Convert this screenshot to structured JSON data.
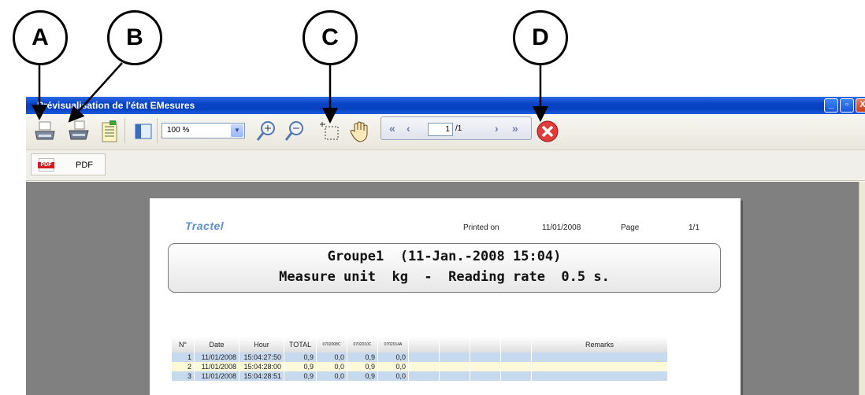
{
  "callouts": [
    "A",
    "B",
    "C",
    "D"
  ],
  "window": {
    "title": "Prévisualisation de l'état EMesures",
    "controls": {
      "minimize": "_",
      "restore": "▫",
      "close": "X"
    }
  },
  "toolbar": {
    "buttons": [
      "print-icon",
      "print-setup-icon",
      "export-icon",
      "page-layout-icon",
      "zoom-in-icon",
      "zoom-out-icon",
      "zoom-select-icon",
      "hand-pan-icon",
      "close-preview-icon"
    ],
    "zoom_value": "100 %",
    "nav": {
      "first": "«",
      "prev": "‹",
      "page": "1",
      "total": "/1",
      "next": "›",
      "last": "»"
    }
  },
  "export_bar": {
    "pdf_icon_text": "PDF",
    "pdf_label": "PDF"
  },
  "report": {
    "logo_text": "Tractel",
    "printed_on_label": "Printed on",
    "printed_on_value": "11/01/2008",
    "page_label": "Page",
    "page_value": "1/1",
    "banner_line1": "Groupe1  (11-Jan.-2008 15:04)",
    "banner_line2": "Measure unit  kg  -  Reading rate  0.5 s.",
    "table": {
      "columns": [
        "N°",
        "Date",
        "Hour",
        "TOTAL",
        "0702008C",
        "0702010C",
        "0702014A",
        "",
        "",
        "",
        "",
        "Remarks"
      ],
      "rows": [
        [
          "1",
          "11/01/2008",
          "15:04:27:50",
          "0,9",
          "0,0",
          "0,9",
          "0,0"
        ],
        [
          "2",
          "11/01/2008",
          "15:04:28:00",
          "0,9",
          "0,0",
          "0,9",
          "0,0"
        ],
        [
          "3",
          "11/01/2008",
          "15:04:28:51",
          "0,9",
          "0,0",
          "0,9",
          "0,0"
        ]
      ]
    }
  }
}
